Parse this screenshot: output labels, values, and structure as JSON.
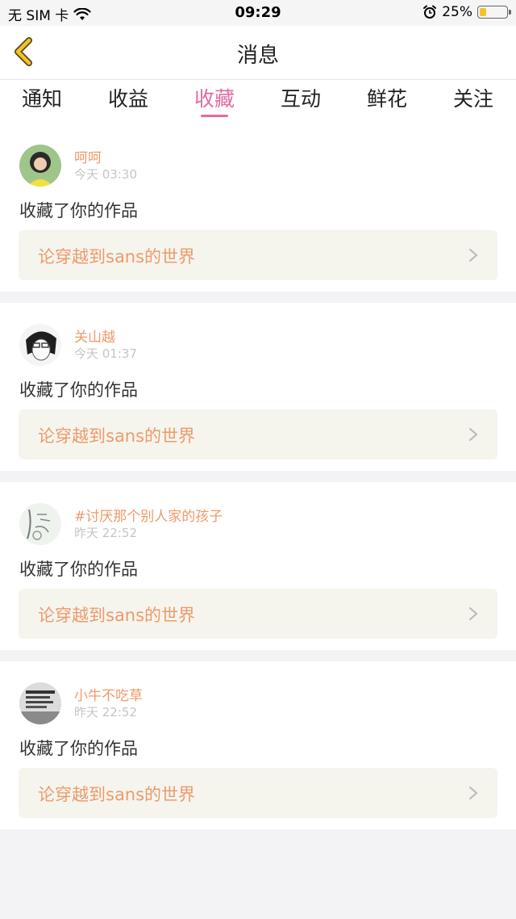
{
  "status_bar": {
    "carrier": "无 SIM 卡",
    "time": "09:29",
    "battery": "25%",
    "battery_level": 0.25,
    "icons": [
      "wifi-icon",
      "alarm-icon",
      "battery-icon"
    ]
  },
  "header": {
    "title": "消息",
    "back_icon": "chevron-left-icon",
    "accent_color": "#f2c22e"
  },
  "tabs": {
    "items": [
      "通知",
      "收益",
      "收藏",
      "互动",
      "鲜花",
      "关注"
    ],
    "active": "收藏",
    "active_color": "#e46aa3"
  },
  "messages": [
    {
      "name": "呵呵",
      "time": "今天 03:30",
      "action": "收藏了你的作品",
      "work": "论穿越到sans的世界"
    },
    {
      "name": "关山越",
      "time": "今天 01:37",
      "action": "收藏了你的作品",
      "work": "论穿越到sans的世界"
    },
    {
      "name": "#讨厌那个别人家的孩子",
      "time": "昨天 22:52",
      "action": "收藏了你的作品",
      "work": "论穿越到sans的世界"
    },
    {
      "name": "小牛不吃草",
      "time": "昨天 22:52",
      "action": "收藏了你的作品",
      "work": "论穿越到sans的世界"
    }
  ],
  "colors": {
    "username": "#ee9a6b",
    "work_title": "#ee9a6b",
    "work_box_bg": "#f5f5ee"
  }
}
